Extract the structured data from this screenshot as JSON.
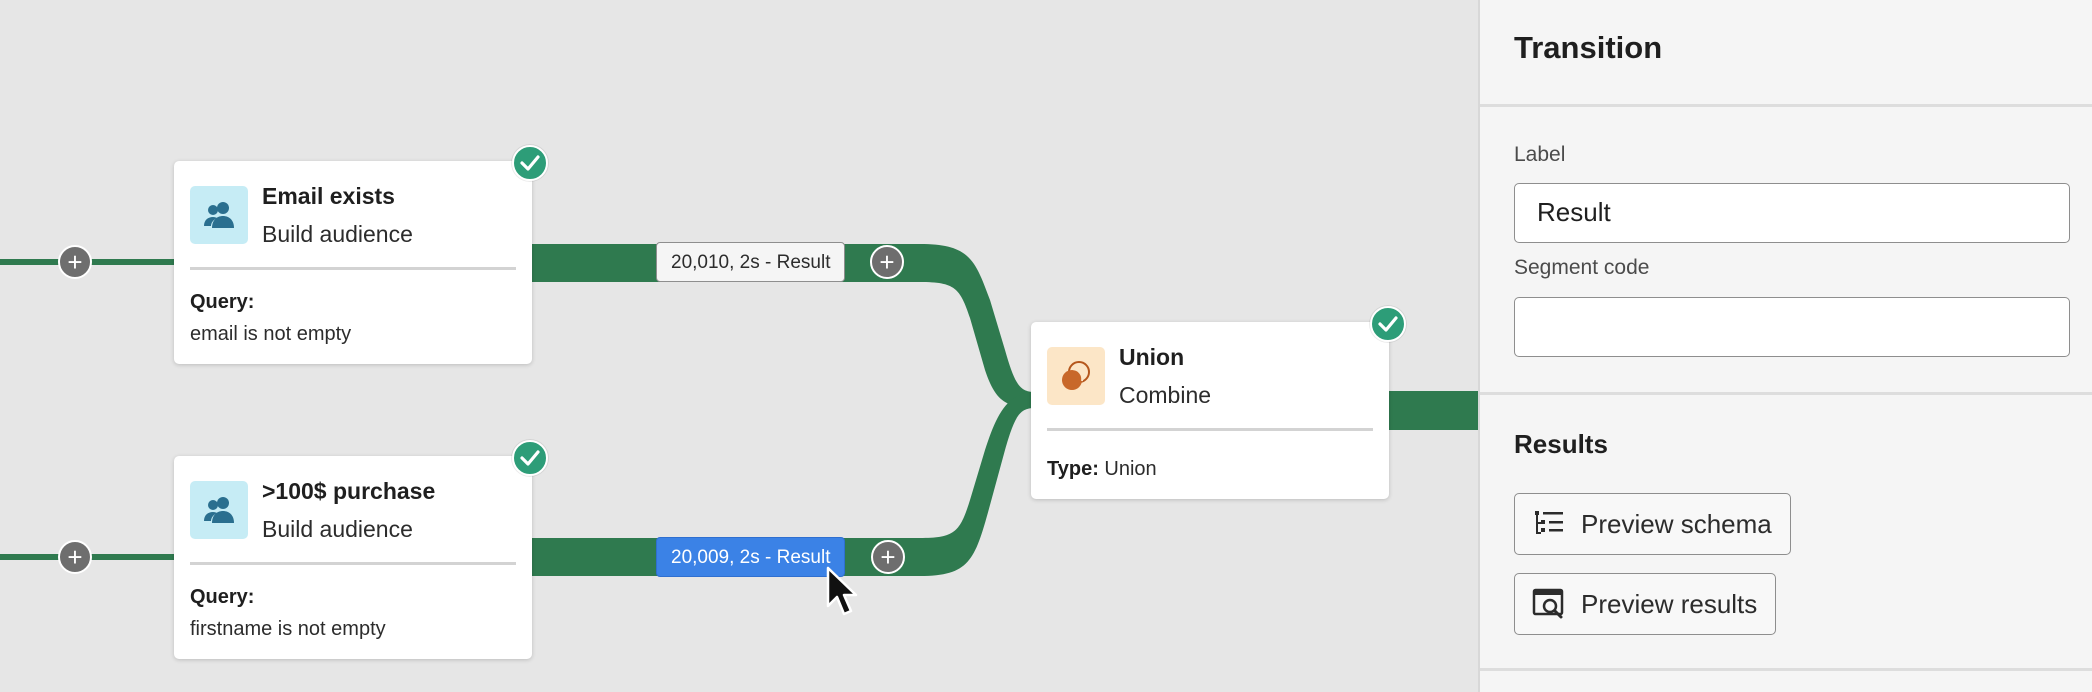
{
  "nodes": {
    "email": {
      "title": "Email exists",
      "subtitle": "Build audience",
      "query_label": "Query:",
      "query_value": "email is not empty",
      "icon": "audience-icon"
    },
    "purchase": {
      "title": ">100$ purchase",
      "subtitle": "Build audience",
      "query_label": "Query:",
      "query_value": "firstname is not empty",
      "icon": "audience-icon"
    },
    "union": {
      "title": "Union",
      "subtitle": "Combine",
      "type_label": "Type:",
      "type_value": "Union",
      "icon": "union-icon"
    }
  },
  "transitions": {
    "top": "20,010, 2s - Result",
    "bottom": "20,009, 2s - Result"
  },
  "panel": {
    "title": "Transition",
    "label_field_label": "Label",
    "label_value": "Result",
    "segment_code_label": "Segment code",
    "segment_code_value": "",
    "results_heading": "Results",
    "preview_schema": "Preview schema",
    "preview_results": "Preview results"
  },
  "colors": {
    "link": "#2f7a4f",
    "check": "#2d9d78",
    "selected_transition": "#3b82e6"
  }
}
